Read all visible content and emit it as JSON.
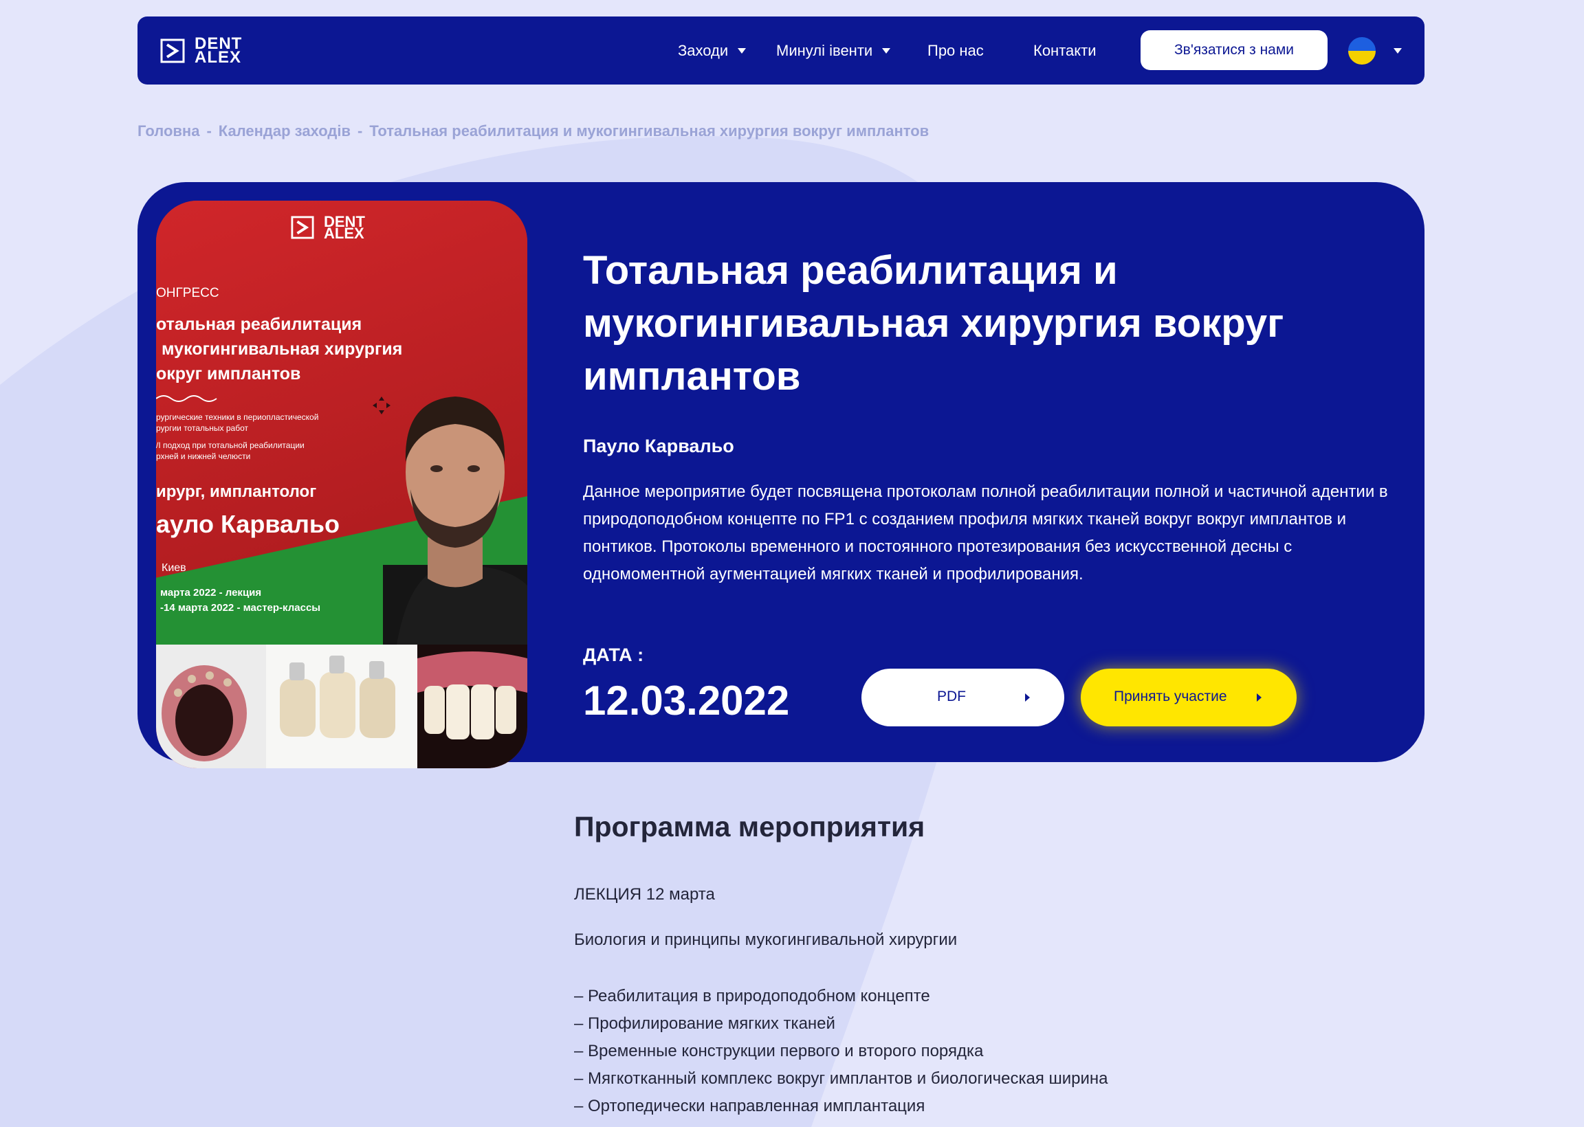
{
  "brand": {
    "line1": "DENT",
    "line2": "ALEX"
  },
  "nav": {
    "items": [
      {
        "label": "Заходи",
        "has_dropdown": true
      },
      {
        "label": "Минулі івенти",
        "has_dropdown": true
      },
      {
        "label": "Про нас",
        "has_dropdown": false
      },
      {
        "label": "Контакти",
        "has_dropdown": false
      }
    ],
    "contact_button": "Зв'язатися з нами",
    "language_flag": "ukraine-flag-icon"
  },
  "breadcrumb": {
    "items": [
      "Головна",
      "Календар заходів",
      "Тотальная реабилитация и мукогингивальная хирургия вокруг имплантов"
    ],
    "separator": "-"
  },
  "poster": {
    "brand_line1": "DENT",
    "brand_line2": "ALEX",
    "kicker": "ОНГРЕСС",
    "title_lines": [
      "отальная реабилитация",
      "мукогингивальная хирургия",
      "округ имплантов"
    ],
    "bullets": [
      [
        "рургические техники в периопластической",
        "рургии тотальных работ"
      ],
      [
        "/I подход при тотальной реабилитации",
        "рхней и нижней челюсти"
      ]
    ],
    "role": "ирург, имплантолог",
    "speaker": "ауло Карвальо",
    "city": "Киев",
    "dates": [
      "марта 2022 - лекция",
      "-14 марта 2022 - мастер-классы"
    ]
  },
  "event": {
    "title": "Тотальная реабилитация и мукогингивальная хирургия вокруг имплантов",
    "title_lines": [
      "Тотальная реабилитация и",
      "мукогингивальная хирургия вокруг",
      "имплантов"
    ],
    "speaker": "Пауло Карвальо",
    "description": "Данное мероприятие будет посвящена протоколам полной реабилитации полной и частичной адентии в природоподобном концепте по FP1 с созданием профиля мягких тканей вокруг вокруг имплантов и понтиков. Протоколы временного и постоянного протезирования без искусственной десны с одномоментной аугментацией мягких тканей и профилирования.",
    "date_label": "ДАТА :",
    "date": "12.03.2022",
    "pdf_button": "PDF",
    "join_button": "Принять участие"
  },
  "program": {
    "title": "Программа мероприятия",
    "lecture_heading": "ЛЕКЦИЯ 12 марта",
    "topic": "Биология и принципы мукогингивальной хирургии",
    "items": [
      "– Реабилитация в природоподобном концепте",
      "– Профилирование мягких тканей",
      "– Временные конструкции первого и второго порядка",
      "– Мягкотканный комплекс вокруг имплантов и биологическая ширина",
      "– Ортопедически направленная имплантация"
    ]
  },
  "colors": {
    "page_bg": "#e4e6fb",
    "brand_navy": "#0c1793",
    "accent_yellow": "#ffe600",
    "poster_red": "#c42127",
    "poster_green": "#249134",
    "breadcrumb_text": "#9aa3d6",
    "body_text": "#23253a"
  }
}
